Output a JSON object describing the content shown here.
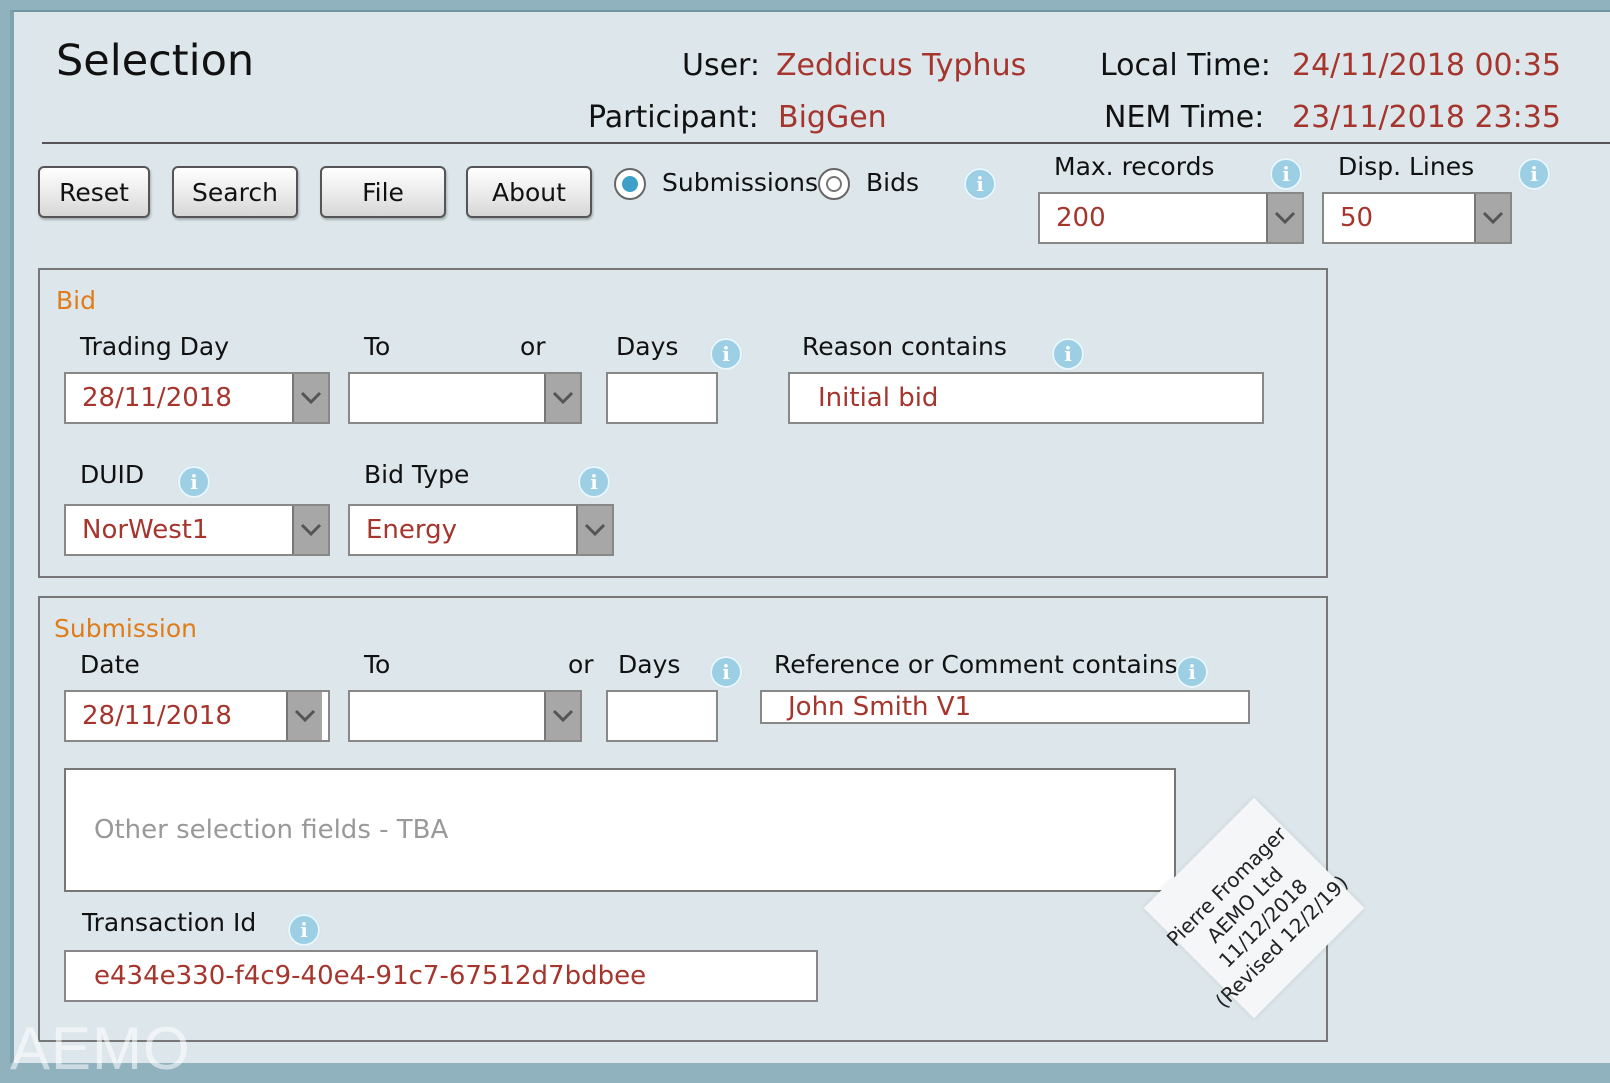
{
  "header": {
    "title": "Selection",
    "user_label": "User:",
    "user_value": "Zeddicus Typhus",
    "participant_label": "Participant:",
    "participant_value": "BigGen",
    "local_time_label": "Local Time:",
    "local_time_value": "24/11/2018 00:35",
    "nem_time_label": "NEM Time:",
    "nem_time_value": "23/11/2018 23:35"
  },
  "toolbar": {
    "reset": "Reset",
    "search": "Search",
    "file": "File",
    "about": "About",
    "mode_options": [
      {
        "label": "Submissions",
        "selected": true
      },
      {
        "label": "Bids",
        "selected": false
      }
    ],
    "max_records_label": "Max. records",
    "max_records_value": "200",
    "disp_lines_label": "Disp. Lines",
    "disp_lines_value": "50"
  },
  "bid": {
    "section_title": "Bid",
    "trading_day_label": "Trading Day",
    "trading_day_value": "28/11/2018",
    "to_label": "To",
    "to_value": "",
    "or_label": "or",
    "days_label": "Days",
    "days_value": "",
    "reason_label": "Reason contains",
    "reason_value": "Initial bid",
    "duid_label": "DUID",
    "duid_value": "NorWest1",
    "bid_type_label": "Bid Type",
    "bid_type_value": "Energy"
  },
  "submission": {
    "section_title": "Submission",
    "date_label": "Date",
    "date_value": "28/11/2018",
    "to_label": "To",
    "to_value": "",
    "or_label": "or",
    "days_label": "Days",
    "days_value": "",
    "ref_label": "Reference or Comment contains",
    "ref_value": "John Smith V1",
    "other_fields": "Other selection fields - TBA",
    "transaction_label": "Transaction Id",
    "transaction_value": "e434e330-f4c9-40e4-91c7-67512d7bdbee"
  },
  "stamp": {
    "line1": "Pierre Fromager",
    "line2": "AEMO Ltd",
    "line3": "11/12/2018",
    "line4": "(Revised 12/2/19)"
  },
  "logo": "AEMO",
  "icons": {
    "info": "info-icon",
    "dropdown": "chevron-down-icon"
  },
  "colors": {
    "value_text": "#a5352d",
    "section_title": "#e07c1a",
    "info_icon": "#9ccfe3",
    "radio_selected": "#3ea0c8",
    "background": "#dde7eb"
  }
}
